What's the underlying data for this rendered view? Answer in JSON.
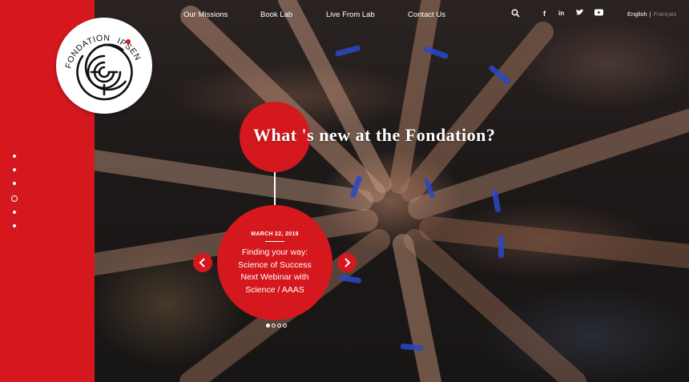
{
  "brand": {
    "logo_text_left": "FONDATION",
    "logo_text_right": "IPSEN",
    "accent_color": "#d5181e"
  },
  "nav": {
    "items": [
      {
        "label": "Our Missions"
      },
      {
        "label": "Book Lab"
      },
      {
        "label": "Live From Lab"
      },
      {
        "label": "Contact Us"
      }
    ],
    "icons": [
      "search-icon",
      "facebook-icon",
      "linkedin-icon",
      "twitter-icon",
      "youtube-icon"
    ],
    "language": {
      "current": "English",
      "separator": "|",
      "other": "Français"
    }
  },
  "hero": {
    "headline": "What 's new at the Fondation?"
  },
  "news_card": {
    "date": "MARCH 22, 2019",
    "title": "Finding your way: Science of Success Next Webinar with Science / AAAS"
  },
  "carousel": {
    "prev_icon": "chevron-left-icon",
    "next_icon": "chevron-right-icon",
    "pages": 4,
    "active_page": 1
  },
  "section_nav": {
    "count": 6,
    "active_index": 4
  }
}
